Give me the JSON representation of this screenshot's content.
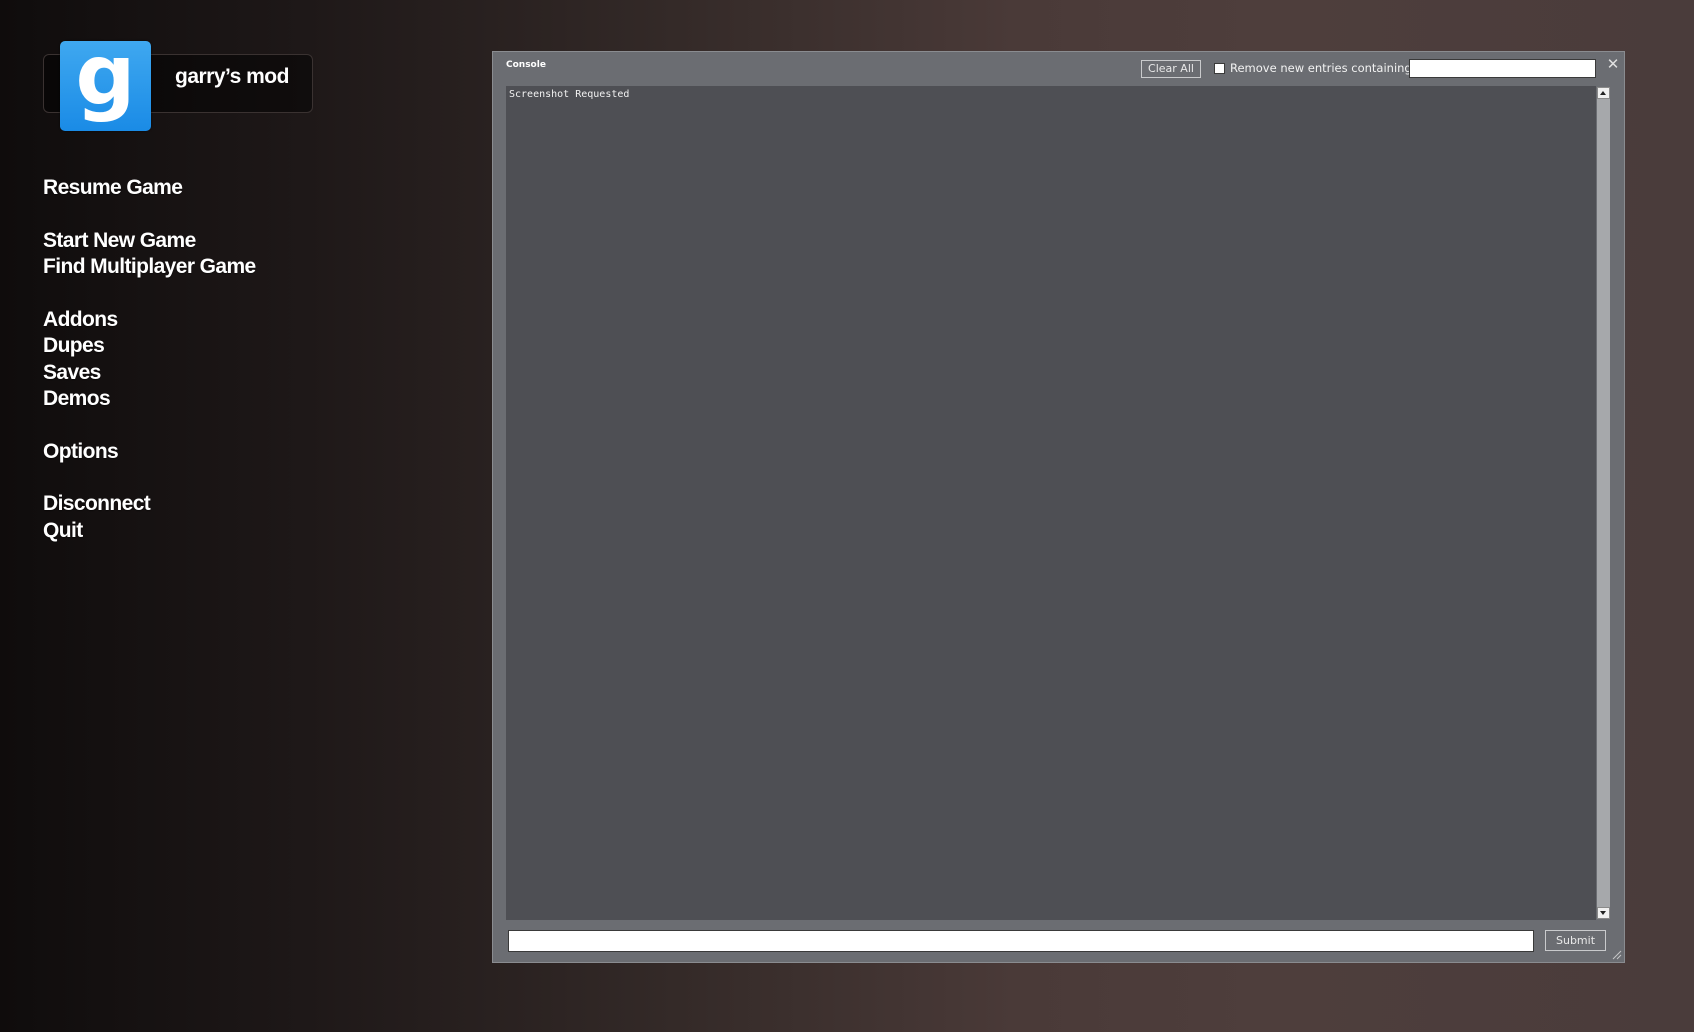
{
  "logo": {
    "letter": "g",
    "text": "garry’s mod"
  },
  "menu": {
    "groups": [
      [
        "Resume Game"
      ],
      [
        "Start New Game",
        "Find Multiplayer Game"
      ],
      [
        "Addons",
        "Dupes",
        "Saves",
        "Demos"
      ],
      [
        "Options"
      ],
      [
        "Disconnect",
        "Quit"
      ]
    ]
  },
  "console": {
    "title": "Console",
    "clear_all_label": "Clear All",
    "filter_label": "Remove new entries containing:",
    "filter_value": "",
    "filter_checked": false,
    "close_glyph": "✕",
    "output_lines": [
      "Screenshot Requested"
    ],
    "command_value": "",
    "submit_label": "Submit"
  }
}
